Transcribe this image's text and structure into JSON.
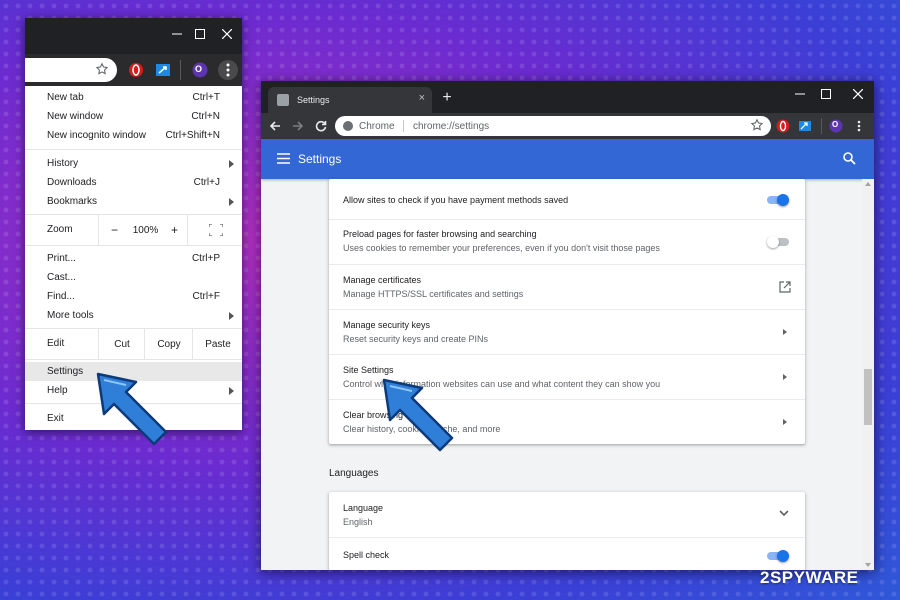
{
  "menu_window": {
    "window_controls": [
      "minimize-icon",
      "maximize-icon",
      "close-icon"
    ],
    "toolbar_icons": [
      "star-icon",
      "opera-extension-icon",
      "share-extension-icon",
      "profile-icon",
      "kebab-menu-icon"
    ],
    "profile_letter": "O",
    "items": [
      {
        "label": "New tab",
        "shortcut": "Ctrl+T"
      },
      {
        "label": "New window",
        "shortcut": "Ctrl+N"
      },
      {
        "label": "New incognito window",
        "shortcut": "Ctrl+Shift+N"
      },
      {
        "label": "History",
        "shortcut": ""
      },
      {
        "label": "Downloads",
        "shortcut": "Ctrl+J"
      },
      {
        "label": "Bookmarks",
        "shortcut": ""
      },
      {
        "label": "Print...",
        "shortcut": "Ctrl+P"
      },
      {
        "label": "Cast...",
        "shortcut": ""
      },
      {
        "label": "Find...",
        "shortcut": "Ctrl+F"
      },
      {
        "label": "More tools",
        "shortcut": ""
      },
      {
        "label": "Settings",
        "shortcut": ""
      },
      {
        "label": "Help",
        "shortcut": ""
      },
      {
        "label": "Exit",
        "shortcut": ""
      }
    ],
    "zoom": {
      "label": "Zoom",
      "minus": "−",
      "value": "100%",
      "plus": "+"
    },
    "edit": {
      "label": "Edit",
      "cut": "Cut",
      "copy": "Copy",
      "paste": "Paste"
    }
  },
  "settings_window": {
    "tab_title": "Settings",
    "tab_close": "×",
    "new_tab": "+",
    "address": {
      "site": "Chrome",
      "url": "chrome://settings"
    },
    "profile_letter": "O",
    "appbar_title": "Settings",
    "rows": [
      {
        "title": "Allow sites to check if you have payment methods saved",
        "subtitle": "",
        "control": "toggle-on"
      },
      {
        "title": "Preload pages for faster browsing and searching",
        "subtitle": "Uses cookies to remember your preferences, even if you don't visit those pages",
        "control": "toggle-off"
      },
      {
        "title": "Manage certificates",
        "subtitle": "Manage HTTPS/SSL certificates and settings",
        "control": "external-link"
      },
      {
        "title": "Manage security keys",
        "subtitle": "Reset security keys and create PINs",
        "control": "chevron"
      },
      {
        "title": "Site Settings",
        "subtitle": "Control what information websites can use and what content they can show you",
        "control": "chevron"
      },
      {
        "title": "Clear browsing data",
        "subtitle": "Clear history, cookies, cache, and more",
        "control": "chevron"
      }
    ],
    "languages_header": "Languages",
    "language_rows": [
      {
        "title": "Language",
        "subtitle": "English",
        "control": "expand"
      },
      {
        "title": "Spell check",
        "subtitle": "",
        "control": "toggle-on"
      }
    ]
  },
  "colors": {
    "accent": "#3367d6",
    "toggle_on": "#1a73e8",
    "arrow": "#2f7fd8"
  },
  "watermark": {
    "text": "2SPYWAR",
    "mark": "E"
  }
}
